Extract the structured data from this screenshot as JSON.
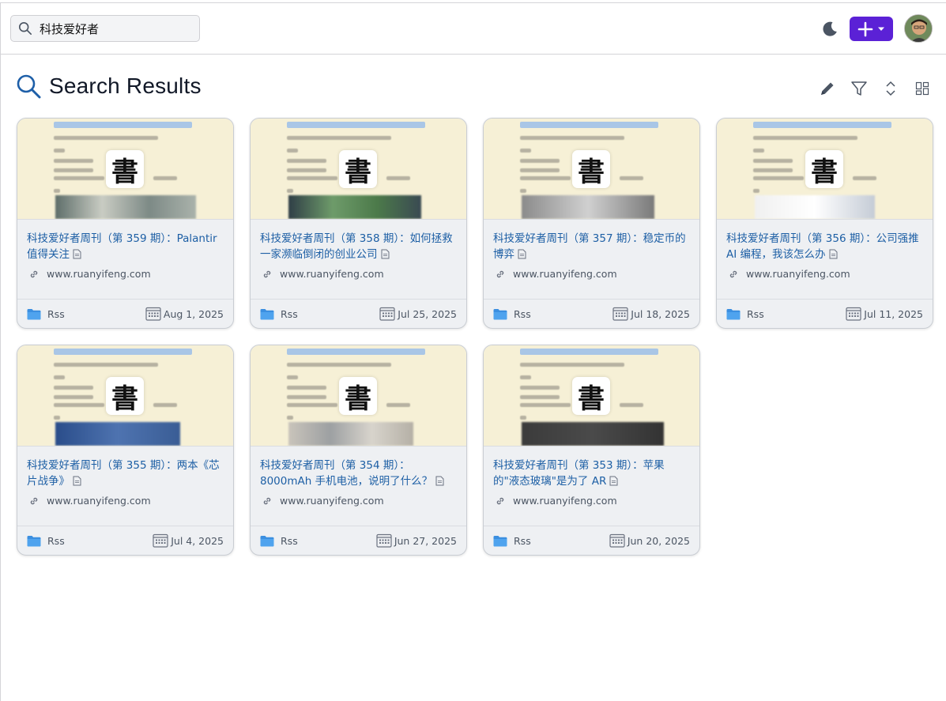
{
  "header": {
    "search_value": "科技爱好者",
    "search_icon": "search-icon",
    "theme_icon": "moon-icon",
    "add_button_icon": "plus-icon",
    "add_menu_icon": "caret-down-icon",
    "avatar_icon": "user-avatar",
    "accent_color": "#5b21d6"
  },
  "page": {
    "title": "Search Results",
    "title_icon": "search-icon",
    "toolbar": [
      "edit-icon",
      "filter-icon",
      "sort-icon",
      "layout-icon"
    ]
  },
  "cards": [
    {
      "title": "科技爱好者周刊（第 359 期）：Palantir 值得关注",
      "domain": "www.ruanyifeng.com",
      "folder": "Rss",
      "date": "Aug 1, 2025"
    },
    {
      "title": "科技爱好者周刊（第 358 期）：如何拯救一家濒临倒闭的创业公司",
      "domain": "www.ruanyifeng.com",
      "folder": "Rss",
      "date": "Jul 25, 2025"
    },
    {
      "title": "科技爱好者周刊（第 357 期）：稳定币的博弈",
      "domain": "www.ruanyifeng.com",
      "folder": "Rss",
      "date": "Jul 18, 2025"
    },
    {
      "title": "科技爱好者周刊（第 356 期）：公司强推 AI 编程，我该怎么办",
      "domain": "www.ruanyifeng.com",
      "folder": "Rss",
      "date": "Jul 11, 2025"
    },
    {
      "title": "科技爱好者周刊（第 355 期）：两本《芯片战争》",
      "domain": "www.ruanyifeng.com",
      "folder": "Rss",
      "date": "Jul 4, 2025"
    },
    {
      "title": "科技爱好者周刊（第 354 期）：8000mAh 手机电池，说明了什么？",
      "domain": "www.ruanyifeng.com",
      "folder": "Rss",
      "date": "Jun 27, 2025"
    },
    {
      "title": "科技爱好者周刊（第 353 期）：苹果的\"液态玻璃\"是为了 AR",
      "domain": "www.ruanyifeng.com",
      "folder": "Rss",
      "date": "Jun 20, 2025"
    }
  ],
  "thumb_logo_glyph": "書"
}
